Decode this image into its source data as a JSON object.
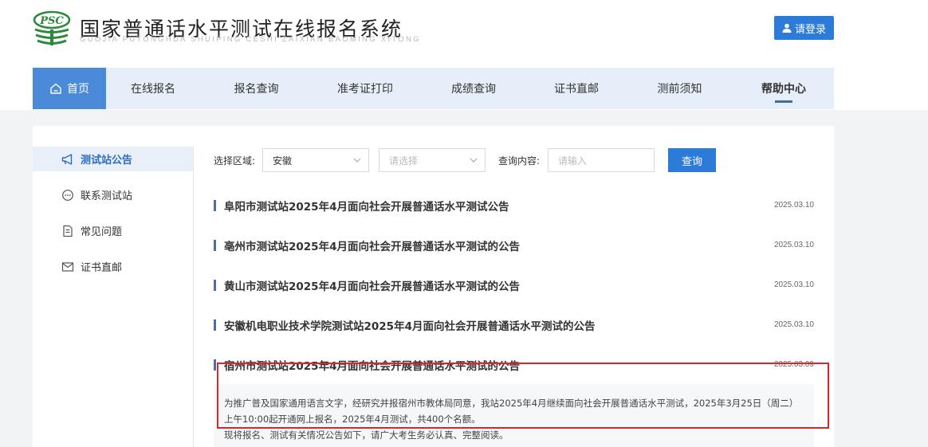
{
  "header": {
    "logo_text": "PSC",
    "title": "国家普通话水平测试在线报名系统",
    "subtitle": "GUOJIA PUTONGHUA SHUIPING CESHI ZAIXIAN BAOMING XITONG",
    "login_label": "请登录"
  },
  "nav": {
    "items": [
      {
        "label": "首页",
        "icon": "home-icon"
      },
      {
        "label": "在线报名"
      },
      {
        "label": "报名查询"
      },
      {
        "label": "准考证打印"
      },
      {
        "label": "成绩查询"
      },
      {
        "label": "证书直邮"
      },
      {
        "label": "测前须知"
      },
      {
        "label": "帮助中心"
      }
    ]
  },
  "sidebar": {
    "items": [
      {
        "label": "测试站公告",
        "icon": "megaphone-icon",
        "active": true
      },
      {
        "label": "联系测试站",
        "icon": "chat-icon"
      },
      {
        "label": "常见问题",
        "icon": "document-icon"
      },
      {
        "label": "证书直邮",
        "icon": "mail-icon"
      }
    ]
  },
  "filter": {
    "region_label": "选择区域:",
    "province_value": "安徽",
    "city_placeholder": "请选择",
    "query_label": "查询内容:",
    "query_placeholder": "请输入",
    "search_label": "查询"
  },
  "notices": [
    {
      "title": "阜阳市测试站2025年4月面向社会开展普通话水平测试公告",
      "date": "2025.03.10"
    },
    {
      "title": "亳州市测试站2025年4月面向社会开展普通话水平测试的公告",
      "date": "2025.03.10"
    },
    {
      "title": "黄山市测试站2025年4月面向社会开展普通话水平测试的公告",
      "date": "2025.03.10"
    },
    {
      "title": "安徽机电职业技术学院测试站2025年4月面向社会开展普通话水平测试的公告",
      "date": "2025.03.10"
    },
    {
      "title": "宿州市测试站2025年4月面向社会开展普通话水平测试的公告",
      "date": "2025.03.09"
    }
  ],
  "expanded_notice": {
    "line1": "为推广普及国家通用语言文字，经研究并报宿州市教体局同意，我站2025年4月继续面向社会开展普通话水平测试，2025年3月25日（周二）",
    "line2": "上午10:00起开通网上报名，2025年4月测试，共400个名额。",
    "line3": "现将报名、测试有关情况公告如下，请广大考生务必认真、完整阅读。"
  },
  "colors": {
    "primary": "#2d7bd8",
    "nav_bg": "#e6eef9",
    "nav_active": "#4a8ad9",
    "highlight_border": "#d9252b"
  }
}
